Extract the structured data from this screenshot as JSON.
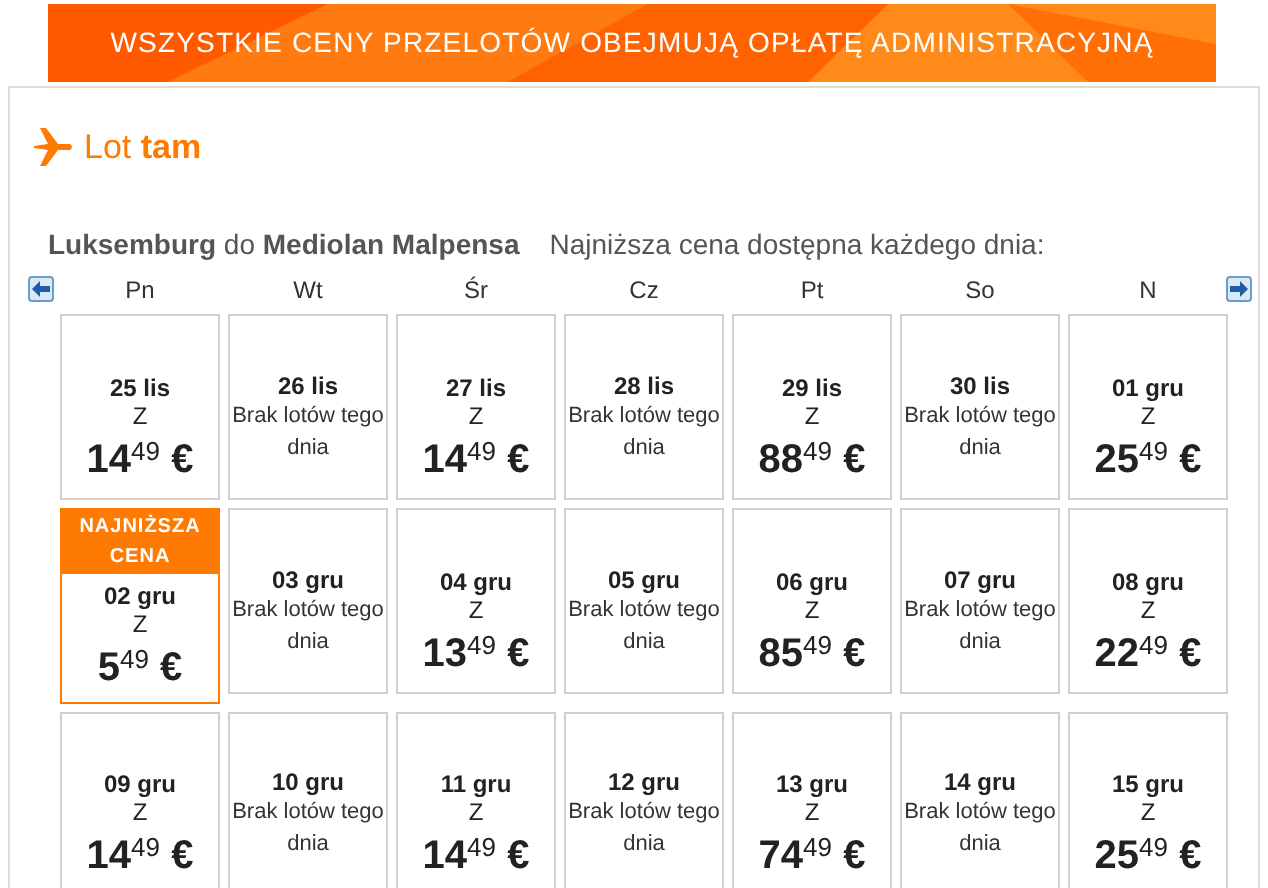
{
  "banner": {
    "text": "WSZYSTKIE CENY PRZELOTÓW OBEJMUJĄ OPŁATĘ ADMINISTRACYJNĄ"
  },
  "section_title": "Lot **tam**",
  "route": "**Luksemburg** do **Mediolan Malpensa**",
  "subtitle": "Najniższa cena dostępna każdego dnia:",
  "days": [
    "Pn",
    "Wt",
    "Śr",
    "Cz",
    "Pt",
    "So",
    "N"
  ],
  "weeks": [
    [
      {
        "kind": "price",
        "date": "25 lis",
        "label": "Z",
        "price": "14$^{49}$ €",
        "lowest": false
      },
      {
        "kind": "none",
        "date": "26 lis",
        "note": "Brak lotów tego dnia"
      },
      {
        "kind": "price",
        "date": "27 lis",
        "label": "Z",
        "price": "14$^{49}$ €",
        "lowest": false
      },
      {
        "kind": "none",
        "date": "28 lis",
        "note": "Brak lotów tego dnia"
      },
      {
        "kind": "price",
        "date": "29 lis",
        "label": "Z",
        "price": "88$^{49}$ €",
        "lowest": false
      },
      {
        "kind": "none",
        "date": "30 lis",
        "note": "Brak lotów tego dnia"
      },
      {
        "kind": "price",
        "date": "01 gru",
        "label": "Z",
        "price": "25$^{49}$ €",
        "lowest": false
      }
    ],
    [
      {
        "kind": "price",
        "date": "02 gru",
        "label": "Z",
        "price": "5$^{49}$ €",
        "lowest": true,
        "badge": "NAJNIŻSZA CENA"
      },
      {
        "kind": "none",
        "date": "03 gru",
        "note": "Brak lotów tego dnia"
      },
      {
        "kind": "price",
        "date": "04 gru",
        "label": "Z",
        "price": "13$^{49}$ €",
        "lowest": false
      },
      {
        "kind": "none",
        "date": "05 gru",
        "note": "Brak lotów tego dnia"
      },
      {
        "kind": "price",
        "date": "06 gru",
        "label": "Z",
        "price": "85$^{49}$ €",
        "lowest": false
      },
      {
        "kind": "none",
        "date": "07 gru",
        "note": "Brak lotów tego dnia"
      },
      {
        "kind": "price",
        "date": "08 gru",
        "label": "Z",
        "price": "22$^{49}$ €",
        "lowest": false
      }
    ],
    [
      {
        "kind": "price",
        "date": "09 gru",
        "label": "Z",
        "price": "14$^{49}$ €",
        "lowest": false
      },
      {
        "kind": "none",
        "date": "10 gru",
        "note": "Brak lotów tego dnia"
      },
      {
        "kind": "price",
        "date": "11 gru",
        "label": "Z",
        "price": "14$^{49}$ €",
        "lowest": false
      },
      {
        "kind": "none",
        "date": "12 gru",
        "note": "Brak lotów tego dnia"
      },
      {
        "kind": "price",
        "date": "13 gru",
        "label": "Z",
        "price": "74$^{49}$ €",
        "lowest": false
      },
      {
        "kind": "none",
        "date": "14 gru",
        "note": "Brak lotów tego dnia"
      },
      {
        "kind": "price",
        "date": "15 gru",
        "label": "Z",
        "price": "25$^{49}$ €",
        "lowest": false
      }
    ]
  ]
}
